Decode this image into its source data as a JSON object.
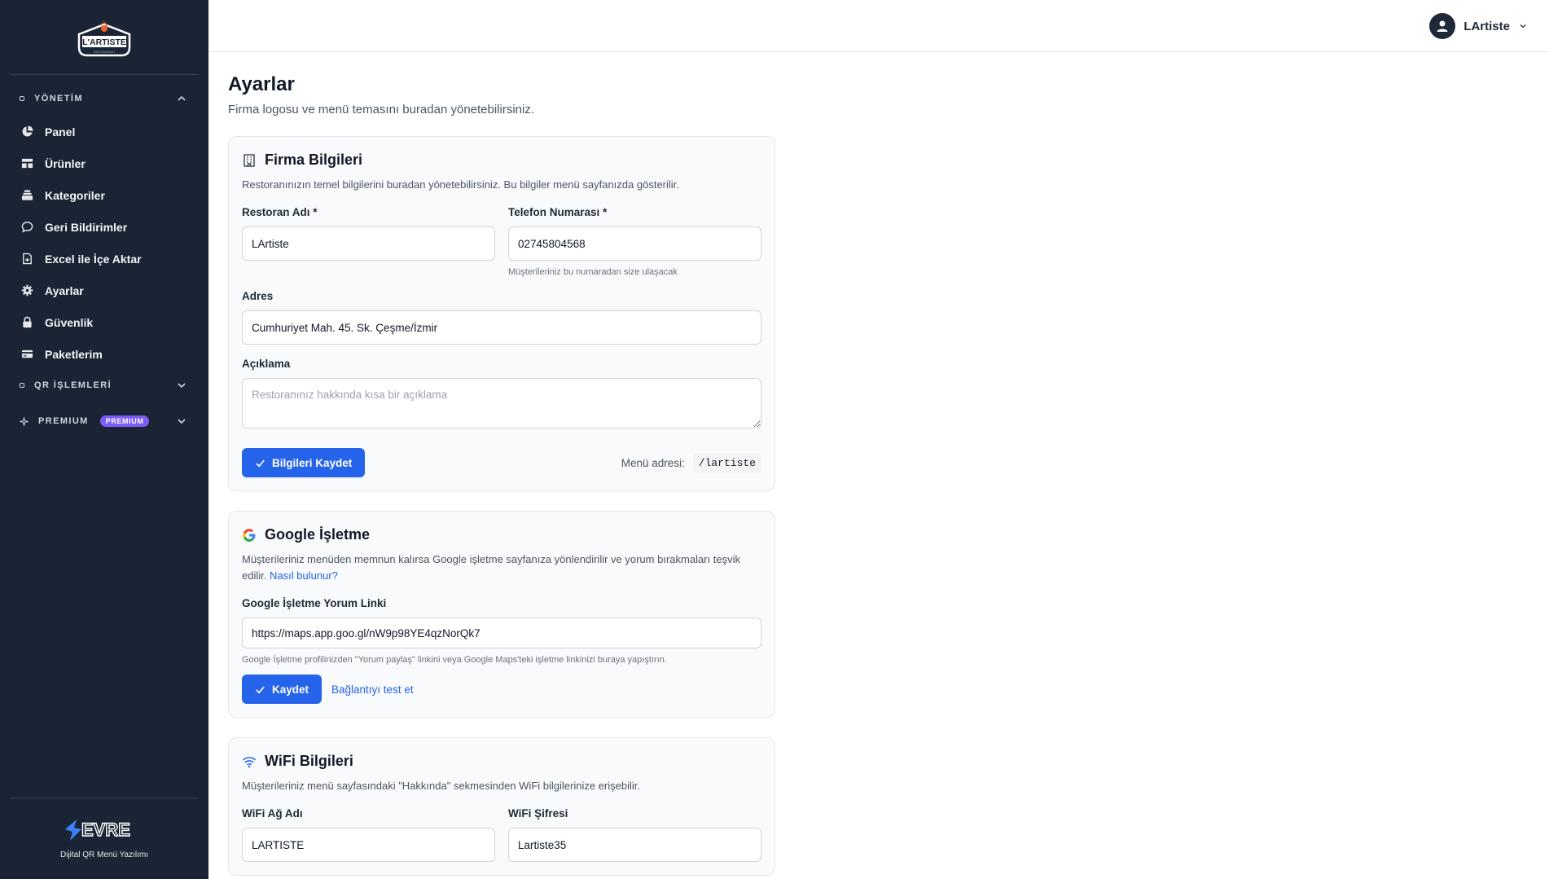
{
  "brand": {
    "logo_text": "L'ARTISTE",
    "footer_brand": "EVRE",
    "footer_tagline": "Dijital QR Menü Yazılımı"
  },
  "sidebar": {
    "sections": {
      "management": "YÖNETİM",
      "qr": "QR İŞLEMLERİ",
      "premium": "PREMIUM",
      "premium_badge": "PREMIUM"
    },
    "items": [
      {
        "label": "Panel",
        "icon": "pie-chart-icon"
      },
      {
        "label": "Ürünler",
        "icon": "grid-icon"
      },
      {
        "label": "Kategoriler",
        "icon": "layers-icon"
      },
      {
        "label": "Geri Bildirimler",
        "icon": "chat-icon"
      },
      {
        "label": "Excel ile İçe Aktar",
        "icon": "file-plus-icon"
      },
      {
        "label": "Ayarlar",
        "icon": "gear-icon"
      },
      {
        "label": "Güvenlik",
        "icon": "lock-icon"
      },
      {
        "label": "Paketlerim",
        "icon": "card-icon"
      }
    ]
  },
  "header": {
    "user_name": "LArtiste"
  },
  "page": {
    "title": "Ayarlar",
    "subtitle": "Firma logosu ve menü temasını buradan yönetebilirsiniz."
  },
  "company": {
    "title": "Firma Bilgileri",
    "description": "Restoranınızın temel bilgilerini buradan yönetebilirsiniz. Bu bilgiler menü sayfanızda gösterilir.",
    "name_label": "Restoran Adı *",
    "name_value": "LArtiste",
    "phone_label": "Telefon Numarası *",
    "phone_value": "02745804568",
    "phone_hint": "Müşterileriniz bu numaradan size ulaşacak",
    "address_label": "Adres",
    "address_value": "Cumhuriyet Mah. 45. Sk. Çeşme/İzmir",
    "desc_label": "Açıklama",
    "desc_placeholder": "Restoranınız hakkında kısa bir açıklama",
    "save_label": "Bilgileri Kaydet",
    "menu_address_label": "Menü adresi:",
    "menu_address_value": "/lartiste"
  },
  "google": {
    "title": "Google İşletme",
    "description": "Müşterileriniz menüden memnun kalırsa Google işletme sayfanıza yönlendirilir ve yorum bırakmaları teşvik edilir.",
    "how_link": "Nasıl bulunur?",
    "link_label": "Google İşletme Yorum Linki",
    "link_value": "https://maps.app.goo.gl/nW9p98YE4qzNorQk7",
    "hint": "Google İşletme profilinizden \"Yorum paylaş\" linkini veya Google Maps'teki işletme linkinizi buraya yapıştırın.",
    "save_label": "Kaydet",
    "test_label": "Bağlantıyı test et"
  },
  "wifi": {
    "title": "WiFi Bilgileri",
    "description": "Müşterileriniz menü sayfasındaki \"Hakkında\" sekmesinden WiFi bilgilerinize erişebilir.",
    "ssid_label": "WiFi Ağ Adı",
    "ssid_value": "LARTISTE",
    "password_label": "WiFi Şifresi",
    "password_value": "Lartiste35"
  },
  "colors": {
    "sidebar_bg": "#1b2434",
    "accent": "#2563eb",
    "premium": "#7c5cf6"
  }
}
